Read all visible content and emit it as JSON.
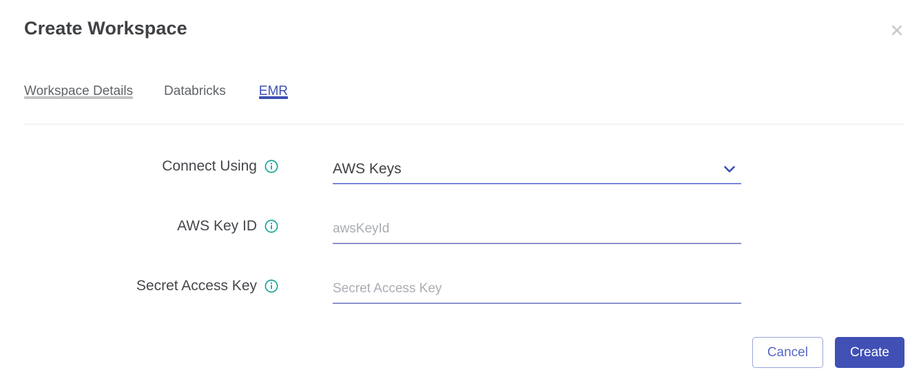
{
  "dialog": {
    "title": "Create Workspace",
    "close_icon": "close-icon"
  },
  "tabs": {
    "items": [
      {
        "label": "Workspace Details",
        "state": "visited"
      },
      {
        "label": "Databricks",
        "state": "default"
      },
      {
        "label": "EMR",
        "state": "active"
      }
    ]
  },
  "form": {
    "rows": [
      {
        "label": "Connect Using",
        "info_icon": "info-icon",
        "control": "select",
        "value": "AWS Keys",
        "chevron_icon": "chevron-down-icon"
      },
      {
        "label": "AWS Key ID",
        "info_icon": "info-icon",
        "control": "text",
        "value": "",
        "placeholder": "awsKeyId"
      },
      {
        "label": "Secret Access Key",
        "info_icon": "info-icon",
        "control": "text",
        "value": "",
        "placeholder": "Secret Access Key"
      }
    ]
  },
  "footer": {
    "cancel_label": "Cancel",
    "create_label": "Create"
  },
  "colors": {
    "accent": "#3f51b5",
    "primary_button": "#4050b5",
    "info_icon": "#17a398",
    "field_underline": "#8a92ca",
    "tab_visited_underline": "#c4c4c4",
    "title_text": "#3f4145",
    "placeholder_text": "#a9adb3"
  }
}
